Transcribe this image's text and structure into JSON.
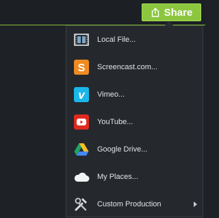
{
  "share_button": {
    "label": "Share",
    "icon": "share-upload-icon",
    "color": "#8cc63f"
  },
  "menu": {
    "items": [
      {
        "label": "Local File...",
        "icon": "film-icon"
      },
      {
        "label": "Screencast.com...",
        "icon": "screencast-icon",
        "color": "#f18b21"
      },
      {
        "label": "Vimeo...",
        "icon": "vimeo-icon",
        "color": "#1ab7ea"
      },
      {
        "label": "YouTube...",
        "icon": "youtube-icon",
        "color": "#e02a20"
      },
      {
        "label": "Google Drive...",
        "icon": "google-drive-icon"
      },
      {
        "label": "My Places...",
        "icon": "cloud-icon"
      },
      {
        "label": "Custom Production",
        "icon": "tools-icon",
        "has_submenu": true
      }
    ]
  }
}
